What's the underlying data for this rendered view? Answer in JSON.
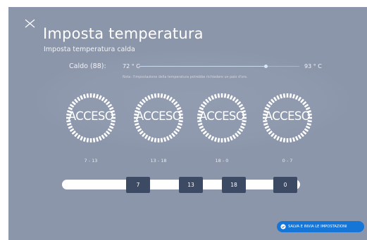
{
  "header": {
    "title": "Imposta temperatura",
    "subtitle": "Imposta temperatura calda"
  },
  "temperature": {
    "label": "Caldo (88):",
    "min": "72 ° C",
    "max": "93 ° C",
    "level": 0.79,
    "note": "Nota: l'impostazione della temperatura potrebbe richiedere un paio d'ore."
  },
  "schedules": [
    {
      "status": "ACCESO",
      "range": "7 - 13"
    },
    {
      "status": "ACCESO",
      "range": "13 - 18"
    },
    {
      "status": "ACCESO",
      "range": "18 - 0"
    },
    {
      "status": "ACCESO",
      "range": "0 - 7"
    }
  ],
  "timeline": {
    "markers": [
      "7",
      "13",
      "18",
      "0"
    ]
  },
  "actions": {
    "save_label": "SALVA E INVIA LE IMPOSTAZIONI"
  },
  "colors": {
    "background": "#8b96ab",
    "marker": "#3d4a63",
    "primary_button": "#1576d8",
    "dial": "#ffffff"
  },
  "icons": {
    "close": "close-icon",
    "save": "check-circle-icon"
  }
}
